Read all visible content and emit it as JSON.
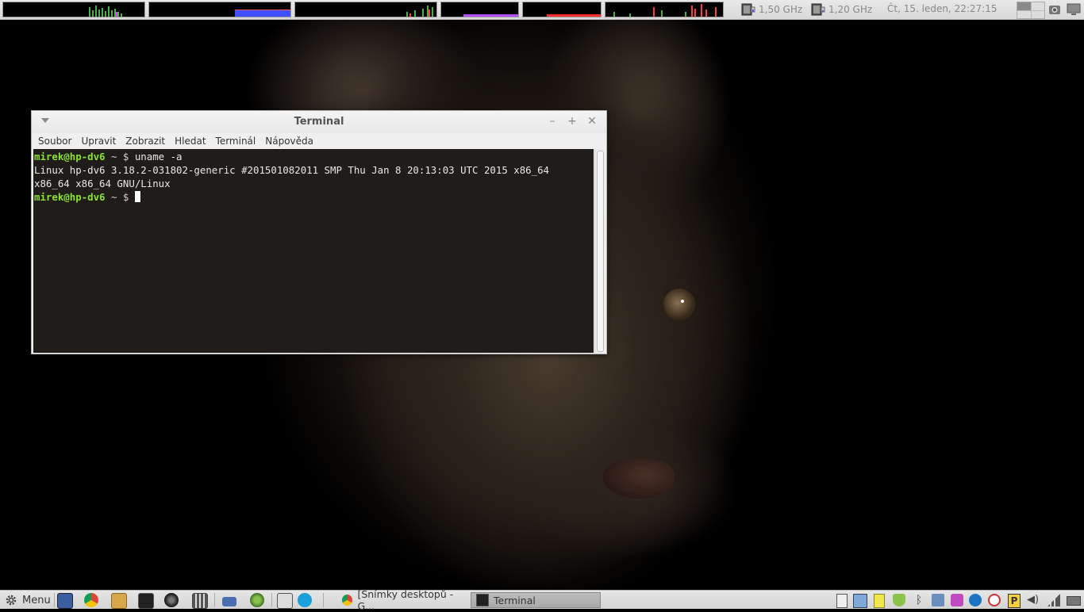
{
  "top_panel": {
    "cpu1": {
      "label": "1,50 GHz"
    },
    "cpu2": {
      "label": "1,20 GHz"
    },
    "clock": "Čt, 15. leden, 22:27:15"
  },
  "terminal": {
    "title": "Terminal",
    "buttons": {
      "minimize": "–",
      "maximize": "+",
      "close": "✕"
    },
    "menu": [
      "Soubor",
      "Upravit",
      "Zobrazit",
      "Hledat",
      "Terminál",
      "Nápověda"
    ],
    "prompt_user": "mirek@hp-dv6",
    "prompt_rest": " ~ $ ",
    "command": "uname -a",
    "output_line1": "Linux hp-dv6 3.18.2-031802-generic #201501082011 SMP Thu Jan 8 20:13:03 UTC 2015 x86_64",
    "output_line2": "x86_64 x86_64 GNU/Linux"
  },
  "bottom_panel": {
    "menu_label": "Menu",
    "tasks": [
      {
        "label": "[Snímky desktopů - G...",
        "active": false
      },
      {
        "label": "Terminal",
        "active": true
      }
    ]
  },
  "colors": {
    "prompt_green": "#8ae234",
    "panel_bg": "#dedede"
  }
}
